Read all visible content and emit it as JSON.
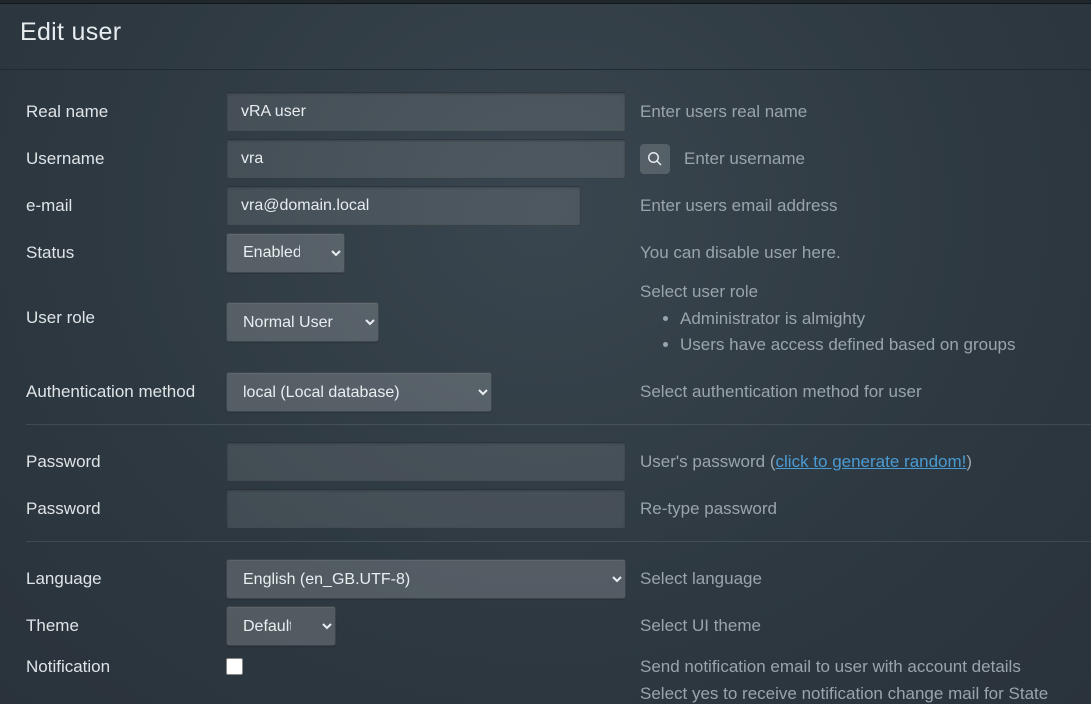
{
  "header": {
    "title": "Edit user"
  },
  "fields": {
    "realname": {
      "label": "Real name",
      "value": "vRA user",
      "hint": "Enter users real name"
    },
    "username": {
      "label": "Username",
      "value": "vra",
      "hint": "Enter username"
    },
    "email": {
      "label": "e-mail",
      "value": "vra@domain.local",
      "hint": "Enter users email address"
    },
    "status": {
      "label": "Status",
      "selected": "Enabled",
      "hint": "You can disable user here."
    },
    "role": {
      "label": "User role",
      "selected": "Normal User",
      "hint_title": "Select user role",
      "hint_items": [
        "Administrator is almighty",
        "Users have access defined based on groups"
      ]
    },
    "auth": {
      "label": "Authentication method",
      "selected": "local (Local database)",
      "hint": "Select authentication method for user"
    },
    "password1": {
      "label": "Password",
      "hint_prefix": "User's password (",
      "hint_link": "click to generate random!",
      "hint_suffix": ")"
    },
    "password2": {
      "label": "Password",
      "hint": "Re-type password"
    },
    "language": {
      "label": "Language",
      "selected": "English (en_GB.UTF-8)",
      "hint": "Select language"
    },
    "theme": {
      "label": "Theme",
      "selected": "Default",
      "hint": "Select UI theme"
    },
    "notification": {
      "label": "Notification",
      "hint": "Send notification email to user with account details"
    },
    "statenotify": {
      "hint": "Select yes to receive notification change mail for State"
    }
  }
}
